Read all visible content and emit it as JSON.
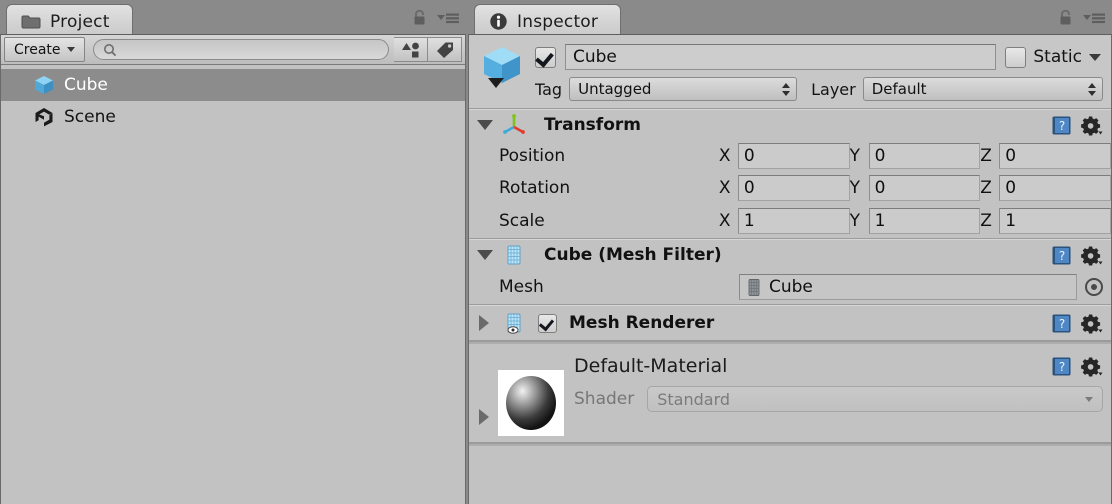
{
  "project_panel": {
    "tab": {
      "label": "Project",
      "icon": "folder-icon"
    },
    "lock_icon": "lock-icon",
    "menu_icon": "panel-menu-icon",
    "toolbar": {
      "create_label": "Create",
      "search_placeholder": "",
      "search_value": "",
      "search_icon": "search-icon",
      "filter_type_icon": "filter-by-type-icon",
      "filter_label_icon": "filter-by-label-icon"
    },
    "items": [
      {
        "label": "Cube",
        "icon": "cube-asset-icon",
        "selected": true
      },
      {
        "label": "Scene",
        "icon": "unity-scene-icon",
        "selected": false
      }
    ]
  },
  "inspector_panel": {
    "tab": {
      "label": "Inspector",
      "icon": "info-icon"
    },
    "lock_icon": "lock-icon",
    "menu_icon": "panel-menu-icon",
    "header": {
      "object_icon": "gameobject-cube-icon",
      "active_checked": true,
      "name_value": "Cube",
      "static_label": "Static",
      "static_checked": false,
      "tag_label": "Tag",
      "tag_value": "Untagged",
      "layer_label": "Layer",
      "layer_value": "Default"
    },
    "components": [
      {
        "title": "Transform",
        "icon": "transform-axis-icon",
        "expanded": true,
        "help_icon": "help-book-icon",
        "gear_icon": "settings-gear-icon",
        "rows": [
          {
            "label": "Position",
            "axes": [
              {
                "letter": "X",
                "value": "0"
              },
              {
                "letter": "Y",
                "value": "0"
              },
              {
                "letter": "Z",
                "value": "0"
              }
            ]
          },
          {
            "label": "Rotation",
            "axes": [
              {
                "letter": "X",
                "value": "0"
              },
              {
                "letter": "Y",
                "value": "0"
              },
              {
                "letter": "Z",
                "value": "0"
              }
            ]
          },
          {
            "label": "Scale",
            "axes": [
              {
                "letter": "X",
                "value": "1"
              },
              {
                "letter": "Y",
                "value": "1"
              },
              {
                "letter": "Z",
                "value": "1"
              }
            ]
          }
        ]
      },
      {
        "title": "Cube (Mesh Filter)",
        "icon": "mesh-filter-icon",
        "expanded": true,
        "help_icon": "help-book-icon",
        "gear_icon": "settings-gear-icon",
        "mesh_label": "Mesh",
        "mesh_value": "Cube",
        "mesh_value_icon": "mesh-asset-icon",
        "mesh_picker_icon": "object-picker-icon"
      },
      {
        "title": "Mesh Renderer",
        "icon": "mesh-renderer-icon",
        "expanded": false,
        "enabled_checked": true,
        "help_icon": "help-book-icon",
        "gear_icon": "settings-gear-icon"
      }
    ],
    "material": {
      "title": "Default-Material",
      "preview_icon": "material-sphere-preview",
      "expanded": false,
      "help_icon": "help-book-icon",
      "gear_icon": "settings-gear-icon",
      "shader_label": "Shader",
      "shader_value": "Standard"
    }
  },
  "colors": {
    "window_bg": "#8a8a8a",
    "panel_bg": "#c2c2c2",
    "selection": "#8c8c8c",
    "tab_bg": "#d6d6d6",
    "text": "#111111",
    "dim_text": "#7b7b7b"
  }
}
